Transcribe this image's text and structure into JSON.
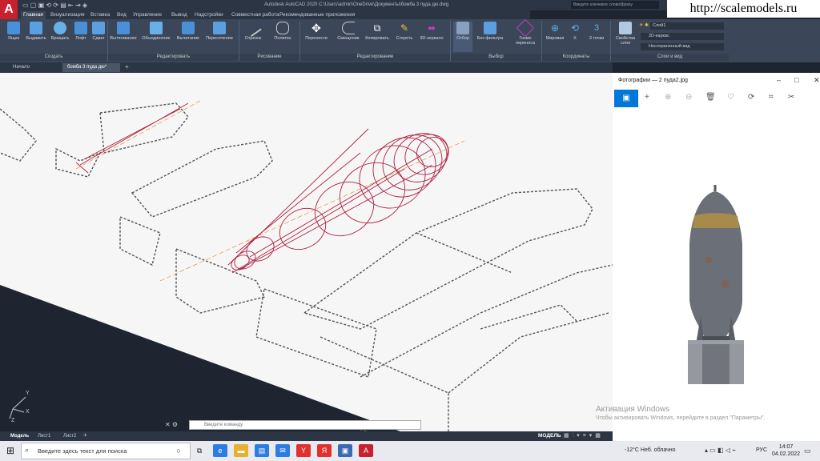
{
  "titlebar": {
    "app_letter": "A",
    "title": "Autodesk AutoCAD 2020   C:\\Users\\admin\\OneDrive\\Документы\\бомба 3 пуда дю.dwg",
    "search_placeholder": "Введите ключевое слово/фразу",
    "watermark": "http://scalemodels.ru"
  },
  "ribbon_tabs": [
    "Главная",
    "Визуализация",
    "Вставка",
    "Вид",
    "Управление",
    "Вывод",
    "Надстройки",
    "Совместная работа",
    "Рекомендованные приложения"
  ],
  "ribbon": {
    "buttons": [
      "Ящик",
      "Выдавить",
      "Вращать",
      "Лофт",
      "Сдвиг",
      "Вытягивание",
      "Объединение",
      "Вычитание",
      "Пересечение",
      "Отрезок",
      "Полигон",
      "Перенести",
      "Смещение",
      "Копировать",
      "Стереть",
      "3D-зеркало",
      "Отбор",
      "Без фильтра",
      "Гизмо переноса",
      "Мировая",
      "X",
      "3 точки",
      "Свойства слоя"
    ],
    "groups": [
      "Создать",
      "Редактировать",
      "Рисование",
      "Редактирование",
      "Выбор",
      "Координаты",
      "Слои и вид"
    ],
    "layer_value": "Слой1",
    "visual_style_value": "2D-каркас",
    "view_value": "Несохраненный вид"
  },
  "file_tabs": [
    "Начало",
    "бомба 3 пуда дю*"
  ],
  "command_placeholder": "Введите команду",
  "layout_tabs": [
    "Модель",
    "Лист1",
    "Лист2"
  ],
  "status_model": "МОДЕЛЬ",
  "photos": {
    "title": "Фотографии — 2 пуда2.jpg",
    "activate_line1": "Активация Windows",
    "activate_line2": "Чтобы активировать Windows, перейдите в раздел \"Параметры\"."
  },
  "taskbar": {
    "search_placeholder": "Введите здесь текст для поиска",
    "weather": "-12°C  Неб. облачно",
    "lang": "РУС",
    "time": "14:07",
    "date": "04.02.2022"
  },
  "ucs": {
    "x": "X",
    "y": "Y",
    "z": "Z"
  }
}
